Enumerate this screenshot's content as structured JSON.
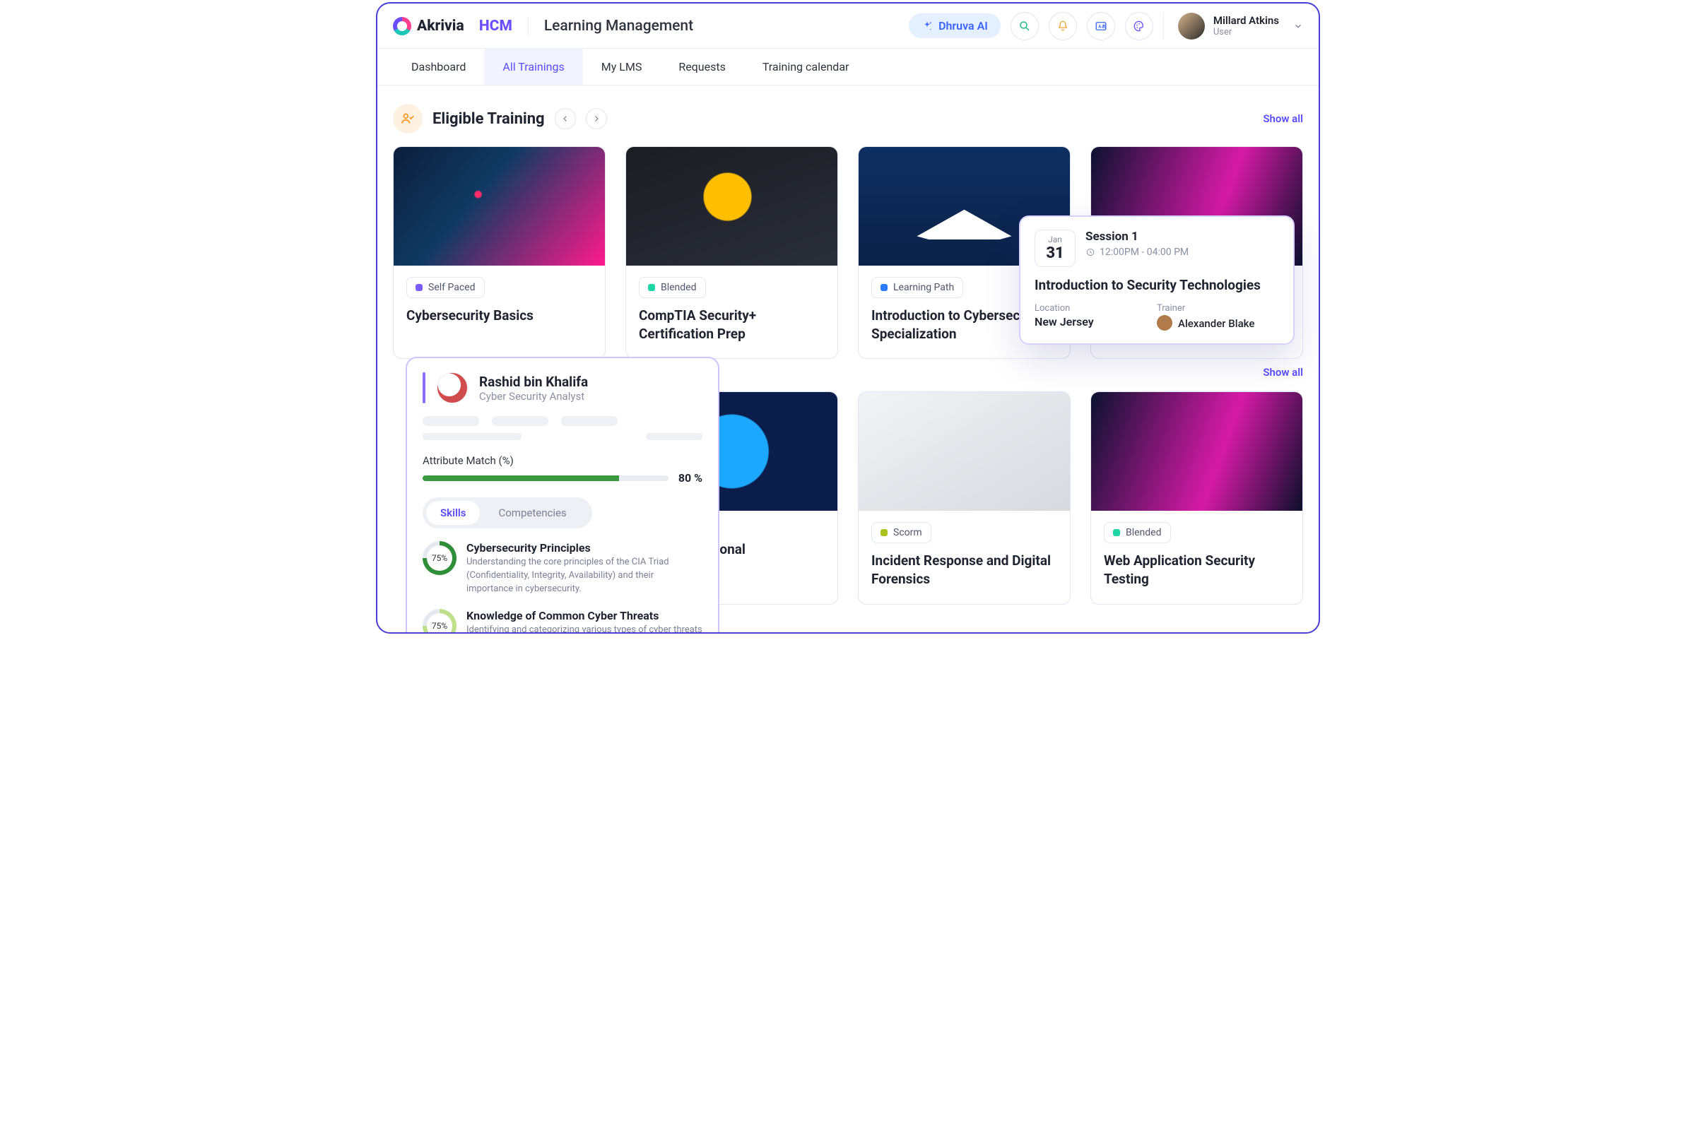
{
  "header": {
    "brand_1": "Akrivia",
    "brand_2": "HCM",
    "page_title": "Learning Management",
    "ai_label": "Dhruva AI",
    "user_name": "Millard Atkins",
    "user_role": "User"
  },
  "tabs": [
    "Dashboard",
    "All Trainings",
    "My LMS",
    "Requests",
    "Training calendar"
  ],
  "active_tab": 1,
  "section1": {
    "title": "Eligible Training",
    "show_all": "Show all",
    "cards": [
      {
        "badge": "Self Paced",
        "dot": "dot-purple",
        "title": "Cybersecurity Basics"
      },
      {
        "badge": "Blended",
        "dot": "dot-teal",
        "title": "CompTIA Security+ Certification Prep"
      },
      {
        "badge": "Learning Path",
        "dot": "dot-blue",
        "title": "Introduction to Cybersecurity Specialization"
      },
      {
        "badge": "",
        "dot": "",
        "title": ""
      }
    ]
  },
  "session_popover": {
    "month": "Jan",
    "day": "31",
    "session": "Session 1",
    "time": "12:00PM - 04:00 PM",
    "title": "Introduction to Security Technologies",
    "location_label": "Location",
    "location_value": "New Jersey",
    "trainer_label": "Trainer",
    "trainer_value": "Alexander Blake"
  },
  "section2": {
    "show_all": "Show all",
    "cards": [
      {
        "badge": "",
        "title_tail": "rmation\nurity Professional"
      },
      {
        "badge": "Scorm",
        "dot": "dot-olive",
        "title": "Incident Response and Digital Forensics"
      },
      {
        "badge": "Blended",
        "dot": "dot-teal",
        "title": "Web Application Security Testing"
      }
    ]
  },
  "profile": {
    "name": "Rashid bin Khalifa",
    "role": "Cyber Security Analyst",
    "attr_label": "Attribute Match (%)",
    "pct": "80 %",
    "seg": [
      "Skills",
      "Competencies"
    ],
    "skills": [
      {
        "pct": "75%",
        "title": "Cybersecurity Principles",
        "desc": "Understanding the core principles of the CIA Triad (Confidentiality, Integrity, Availability) and their importance in cybersecurity."
      },
      {
        "pct": "75%",
        "title": "Knowledge of Common Cyber Threats",
        "desc": "Identifying and categorizing various types of cyber threats (malware, phishing, ransomware, etc.)"
      }
    ]
  }
}
